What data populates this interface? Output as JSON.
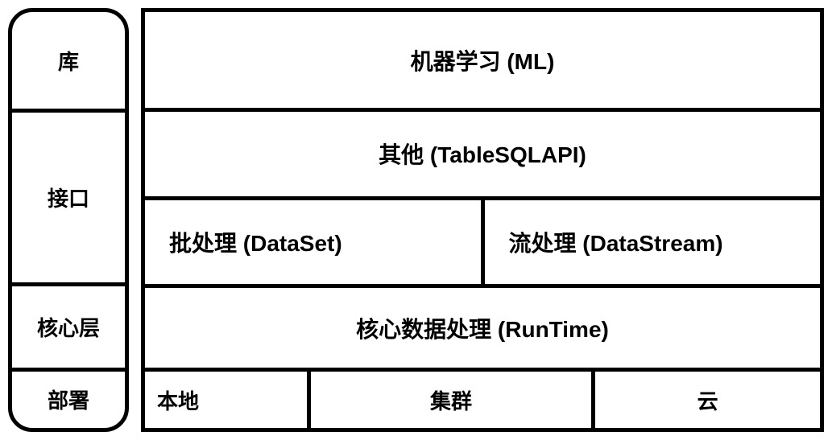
{
  "left": {
    "lib": "库",
    "api": "接口",
    "core": "核心层",
    "deploy": "部署"
  },
  "right": {
    "ml": "机器学习 (ML)",
    "other": "其他 (TableSQLAPI)",
    "batch": "批处理  (DataSet)",
    "stream": "流处理 (DataStream)",
    "core": "核心数据处理 (RunTime)",
    "local": "本地",
    "cluster": "集群",
    "cloud": "云"
  }
}
